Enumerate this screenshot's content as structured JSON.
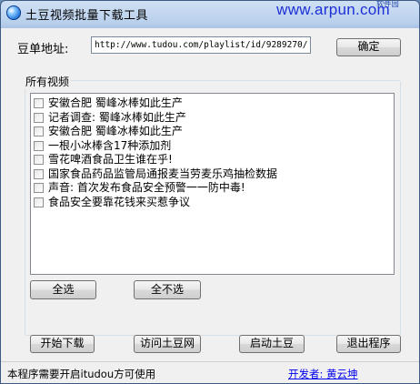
{
  "window": {
    "title": "土豆视频批量下载工具",
    "watermark": "www.arpun.com",
    "watermark_sub": "软件园"
  },
  "url_row": {
    "label": "豆单地址:",
    "value": "http://www.tudou.com/playlist/id/9289270/",
    "confirm_label": "确定"
  },
  "videos": {
    "caption": "所有视频",
    "items": [
      {
        "label": "安徽合肥 蜀峰冰棒如此生产",
        "checked": false
      },
      {
        "label": "记者调查: 蜀峰冰棒如此生产",
        "checked": false
      },
      {
        "label": "安徽合肥 蜀峰冰棒如此生产",
        "checked": false
      },
      {
        "label": "一根小冰棒含17种添加剂",
        "checked": false
      },
      {
        "label": "雪花啤酒食品卫生谁在乎!",
        "checked": false
      },
      {
        "label": "国家食品药品监管局通报麦当劳麦乐鸡抽检数据",
        "checked": false
      },
      {
        "label": "声音: 首次发布食品安全预警一一防中毒!",
        "checked": false
      },
      {
        "label": "食品安全要靠花钱来买惹争议",
        "checked": false
      }
    ],
    "select_all_label": "全选",
    "select_none_label": "全不选"
  },
  "actions": {
    "start_label": "开始下载",
    "visit_label": "访问土豆网",
    "launch_label": "启动土豆",
    "exit_label": "退出程序"
  },
  "status": {
    "message": "本程序需要开启itudou方可使用",
    "developer_link": "开发者: 黄云坤"
  }
}
